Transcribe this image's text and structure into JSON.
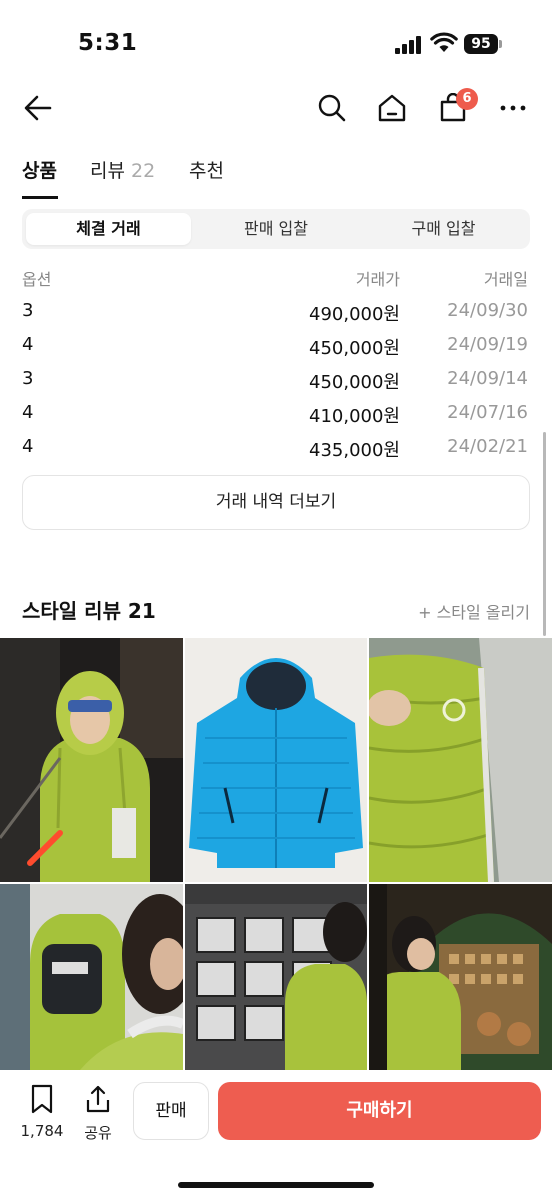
{
  "status_bar": {
    "time": "5:31",
    "battery": "95"
  },
  "nav": {
    "cart_count": "6",
    "icons": [
      "back-arrow-icon",
      "search-icon",
      "home-icon",
      "shopping-bag-icon",
      "more-icon"
    ]
  },
  "tabs": [
    {
      "label": "상품",
      "count": ""
    },
    {
      "label": "리뷰",
      "count": "22"
    },
    {
      "label": "추천",
      "count": ""
    }
  ],
  "segmented": [
    "체결 거래",
    "판매 입찰",
    "구매 입찰"
  ],
  "table": {
    "headers": {
      "option": "옵션",
      "price": "거래가",
      "date": "거래일"
    },
    "rows": [
      {
        "option": "3",
        "price": "490,000원",
        "date": "24/09/30"
      },
      {
        "option": "4",
        "price": "450,000원",
        "date": "24/09/19"
      },
      {
        "option": "3",
        "price": "450,000원",
        "date": "24/09/14"
      },
      {
        "option": "4",
        "price": "410,000원",
        "date": "24/07/16"
      },
      {
        "option": "4",
        "price": "435,000원",
        "date": "24/02/21"
      }
    ]
  },
  "more_button": "거래 내역 더보기",
  "style_review": {
    "title": "스타일 리뷰 21",
    "upload": "+ 스타일 올리기"
  },
  "bottom": {
    "bookmark_count": "1,784",
    "share_label": "공유",
    "sell_label": "판매",
    "buy_label": "구매하기"
  },
  "colors": {
    "accent": "#ee5d50",
    "badge": "#ee5b4c",
    "jacket_green": "#a6c23a",
    "jacket_blue": "#1ea6e2"
  }
}
